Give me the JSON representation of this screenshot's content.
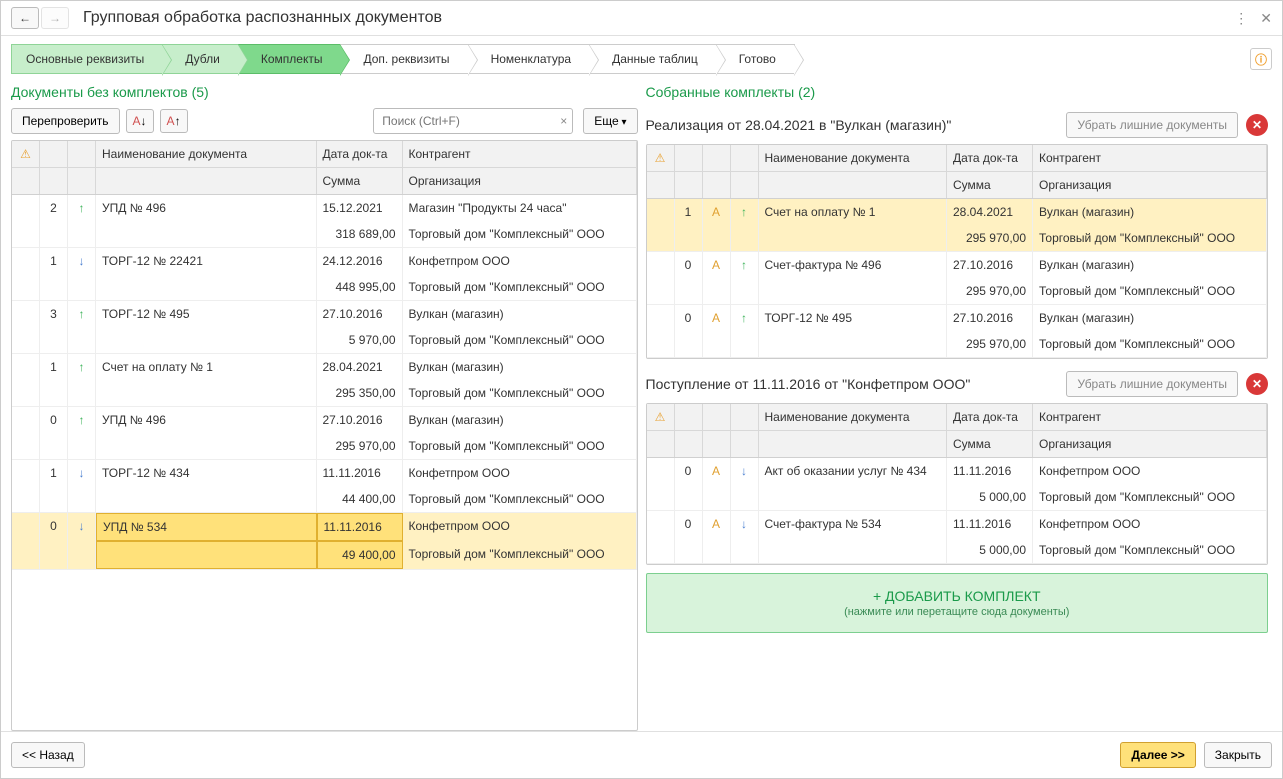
{
  "window": {
    "title": "Групповая обработка распознанных документов"
  },
  "steps": [
    {
      "label": "Основные реквизиты",
      "state": "done"
    },
    {
      "label": "Дубли",
      "state": "done"
    },
    {
      "label": "Комплекты",
      "state": "active"
    },
    {
      "label": "Доп. реквизиты",
      "state": ""
    },
    {
      "label": "Номенклатура",
      "state": ""
    },
    {
      "label": "Данные таблиц",
      "state": ""
    },
    {
      "label": "Готово",
      "state": ""
    }
  ],
  "left": {
    "title": "Документы без комплектов (5)",
    "actions": {
      "recheck": "Перепроверить",
      "more": "Еще",
      "search_placeholder": "Поиск (Ctrl+F)"
    },
    "headers": {
      "name": "Наименование документа",
      "date": "Дата док-та",
      "party": "Контрагент",
      "sum": "Сумма",
      "org": "Организация"
    },
    "rows": [
      {
        "num": "2",
        "dir": "up",
        "name": "УПД № 496",
        "date": "15.12.2021",
        "party": "Магазин \"Продукты 24 часа\"",
        "sum": "318 689,00",
        "org": "Торговый дом \"Комплексный\" ООО"
      },
      {
        "num": "1",
        "dir": "down",
        "name": "ТОРГ-12 № 22421",
        "date": "24.12.2016",
        "party": "Конфетпром ООО",
        "sum": "448 995,00",
        "org": "Торговый дом \"Комплексный\" ООО"
      },
      {
        "num": "3",
        "dir": "up",
        "name": "ТОРГ-12 № 495",
        "date": "27.10.2016",
        "party": "Вулкан (магазин)",
        "sum": "5 970,00",
        "org": "Торговый дом \"Комплексный\" ООО"
      },
      {
        "num": "1",
        "dir": "up",
        "name": "Счет на оплату № 1",
        "date": "28.04.2021",
        "party": "Вулкан (магазин)",
        "sum": "295 350,00",
        "org": "Торговый дом \"Комплексный\" ООО"
      },
      {
        "num": "0",
        "dir": "up",
        "name": "УПД № 496",
        "date": "27.10.2016",
        "party": "Вулкан (магазин)",
        "sum": "295 970,00",
        "org": "Торговый дом \"Комплексный\" ООО"
      },
      {
        "num": "1",
        "dir": "down",
        "name": "ТОРГ-12 № 434",
        "date": "11.11.2016",
        "party": "Конфетпром ООО",
        "sum": "44 400,00",
        "org": "Торговый дом \"Комплексный\" ООО"
      },
      {
        "num": "0",
        "dir": "down",
        "name": "УПД № 534",
        "date": "11.11.2016",
        "party": "Конфетпром ООО",
        "sum": "49 400,00",
        "org": "Торговый дом \"Комплексный\" ООО",
        "selected": true
      }
    ]
  },
  "right": {
    "title": "Собранные комплекты (2)",
    "remove_extra": "Убрать лишние документы",
    "headers": {
      "name": "Наименование документа",
      "date": "Дата док-та",
      "party": "Контрагент",
      "sum": "Сумма",
      "org": "Организация"
    },
    "sets": [
      {
        "title": "Реализация от 28.04.2021 в \"Вулкан (магазин)\"",
        "rows": [
          {
            "num": "1",
            "auto": true,
            "dir": "up",
            "name": "Счет на оплату № 1",
            "date": "28.04.2021",
            "party": "Вулкан (магазин)",
            "sum": "295 970,00",
            "org": "Торговый дом \"Комплексный\" ООО",
            "selected": true
          },
          {
            "num": "0",
            "auto": true,
            "dir": "up",
            "name": "Счет-фактура № 496",
            "date": "27.10.2016",
            "party": "Вулкан (магазин)",
            "sum": "295 970,00",
            "org": "Торговый дом \"Комплексный\" ООО"
          },
          {
            "num": "0",
            "auto": true,
            "dir": "up",
            "name": "ТОРГ-12 № 495",
            "date": "27.10.2016",
            "party": "Вулкан (магазин)",
            "sum": "295 970,00",
            "org": "Торговый дом \"Комплексный\" ООО"
          }
        ]
      },
      {
        "title": "Поступление от 11.11.2016 от \"Конфетпром ООО\"",
        "rows": [
          {
            "num": "0",
            "auto": true,
            "dir": "down",
            "name": "Акт об оказании услуг № 434",
            "date": "11.11.2016",
            "party": "Конфетпром ООО",
            "sum": "5 000,00",
            "org": "Торговый дом \"Комплексный\" ООО"
          },
          {
            "num": "0",
            "auto": true,
            "dir": "down",
            "name": "Счет-фактура № 534",
            "date": "11.11.2016",
            "party": "Конфетпром ООО",
            "sum": "5 000,00",
            "org": "Торговый дом \"Комплексный\" ООО",
            "hl_sum": true
          }
        ]
      }
    ],
    "add_set": {
      "t1": "+ ДОБАВИТЬ КОМПЛЕКТ",
      "t2": "(нажмите или перетащите сюда документы)"
    }
  },
  "footer": {
    "back": "<< Назад",
    "next": "Далее >>",
    "close": "Закрыть"
  }
}
